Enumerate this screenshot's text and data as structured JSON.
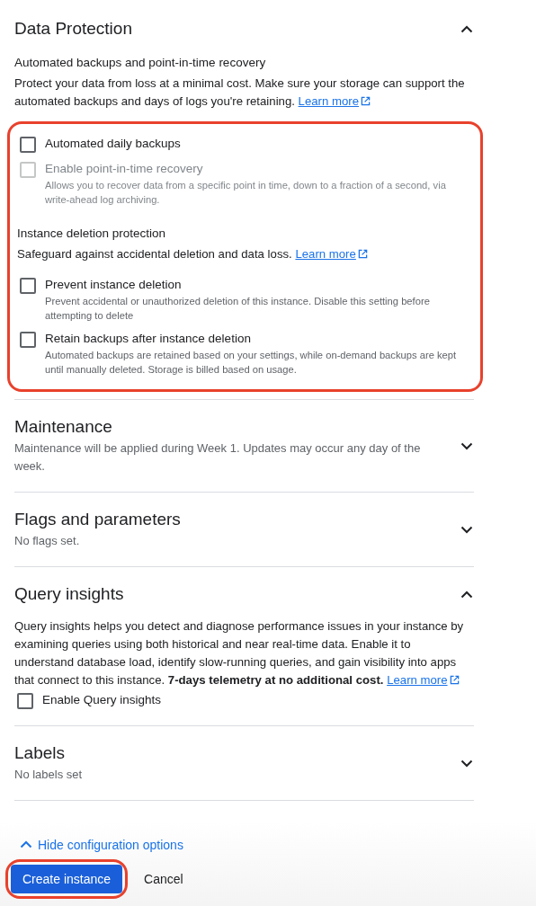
{
  "data_protection": {
    "title": "Data Protection",
    "expanded": true,
    "heading": "Automated backups and point-in-time recovery",
    "description": "Protect your data from loss at a minimal cost. Make sure your storage can support the automated backups and days of logs you're retaining.",
    "link": "Learn more",
    "highlighted": true,
    "options": [
      {
        "label": "Automated daily backups",
        "checked": false,
        "disabled": false
      },
      {
        "label": "Enable point-in-time recovery",
        "checked": false,
        "disabled": true,
        "help": "Allows you to recover data from a specific point in time, down to a fraction of a second, via write-ahead log archiving."
      }
    ],
    "deletion": {
      "heading": "Instance deletion protection",
      "description": "Safeguard against accidental deletion and data loss.",
      "link": "Learn more",
      "options": [
        {
          "label": "Prevent instance deletion",
          "checked": false,
          "disabled": false,
          "help": "Prevent accidental or unauthorized deletion of this instance. Disable this setting before attempting to delete"
        },
        {
          "label": "Retain backups after instance deletion",
          "checked": false,
          "disabled": false,
          "help": "Automated backups are retained based on your settings, while on-demand backups are kept until manually deleted. Storage is billed based on usage."
        }
      ]
    }
  },
  "sections": [
    {
      "title": "Maintenance",
      "expanded": false,
      "summary": "Maintenance will be applied during Week 1. Updates may occur any day of the week."
    },
    {
      "title": "Flags and parameters",
      "expanded": false,
      "summary": "No flags set."
    },
    {
      "title": "Query insights",
      "expanded": true,
      "description": "Query insights helps you detect and diagnose performance issues in your instance by examining queries using both historical and near real-time data. Enable it to understand database load, identify slow-running queries, and gain visibility into apps that connect to this instance. **7-days telemetry at no additional cost.**",
      "link": "Learn more",
      "options": [
        {
          "label": "Enable Query insights",
          "checked": false,
          "disabled": false
        }
      ]
    },
    {
      "title": "Labels",
      "expanded": false,
      "summary": "No labels set"
    }
  ],
  "footer": {
    "toggle": "Hide configuration options",
    "create": {
      "label": "Create instance",
      "highlighted": true
    },
    "cancel": "Cancel"
  }
}
